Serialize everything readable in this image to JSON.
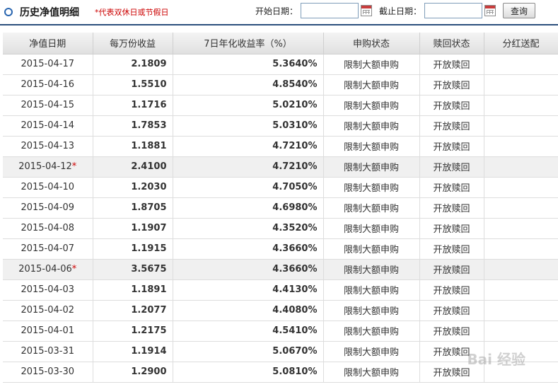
{
  "header": {
    "title": "历史净值明细",
    "note": "*代表双休日或节假日"
  },
  "filters": {
    "start_label": "开始日期：",
    "start_value": "",
    "end_label": "截止日期：",
    "end_value": "",
    "query_label": "查询"
  },
  "table": {
    "columns": [
      "净值日期",
      "每万份收益",
      "7日年化收益率（%）",
      "申购状态",
      "赎回状态",
      "分红送配"
    ],
    "rows": [
      {
        "date": "2015-04-17",
        "star": "",
        "income": "2.1809",
        "rate": "5.3640%",
        "buy": "限制大额申购",
        "redeem": "开放赎回",
        "dividend": ""
      },
      {
        "date": "2015-04-16",
        "star": "",
        "income": "1.5510",
        "rate": "4.8540%",
        "buy": "限制大额申购",
        "redeem": "开放赎回",
        "dividend": ""
      },
      {
        "date": "2015-04-15",
        "star": "",
        "income": "1.1716",
        "rate": "5.0210%",
        "buy": "限制大额申购",
        "redeem": "开放赎回",
        "dividend": ""
      },
      {
        "date": "2015-04-14",
        "star": "",
        "income": "1.7853",
        "rate": "5.0310%",
        "buy": "限制大额申购",
        "redeem": "开放赎回",
        "dividend": ""
      },
      {
        "date": "2015-04-13",
        "star": "",
        "income": "1.1881",
        "rate": "4.7210%",
        "buy": "限制大额申购",
        "redeem": "开放赎回",
        "dividend": ""
      },
      {
        "date": "2015-04-12",
        "star": "*",
        "income": "2.4100",
        "rate": "4.7210%",
        "buy": "限制大额申购",
        "redeem": "开放赎回",
        "dividend": ""
      },
      {
        "date": "2015-04-10",
        "star": "",
        "income": "1.2030",
        "rate": "4.7050%",
        "buy": "限制大额申购",
        "redeem": "开放赎回",
        "dividend": ""
      },
      {
        "date": "2015-04-09",
        "star": "",
        "income": "1.8705",
        "rate": "4.6980%",
        "buy": "限制大额申购",
        "redeem": "开放赎回",
        "dividend": ""
      },
      {
        "date": "2015-04-08",
        "star": "",
        "income": "1.1907",
        "rate": "4.3520%",
        "buy": "限制大额申购",
        "redeem": "开放赎回",
        "dividend": ""
      },
      {
        "date": "2015-04-07",
        "star": "",
        "income": "1.1915",
        "rate": "4.3660%",
        "buy": "限制大额申购",
        "redeem": "开放赎回",
        "dividend": ""
      },
      {
        "date": "2015-04-06",
        "star": "*",
        "income": "3.5675",
        "rate": "4.3660%",
        "buy": "限制大额申购",
        "redeem": "开放赎回",
        "dividend": ""
      },
      {
        "date": "2015-04-03",
        "star": "",
        "income": "1.1891",
        "rate": "4.4130%",
        "buy": "限制大额申购",
        "redeem": "开放赎回",
        "dividend": ""
      },
      {
        "date": "2015-04-02",
        "star": "",
        "income": "1.2077",
        "rate": "4.4080%",
        "buy": "限制大额申购",
        "redeem": "开放赎回",
        "dividend": ""
      },
      {
        "date": "2015-04-01",
        "star": "",
        "income": "1.2175",
        "rate": "4.5410%",
        "buy": "限制大额申购",
        "redeem": "开放赎回",
        "dividend": ""
      },
      {
        "date": "2015-03-31",
        "star": "",
        "income": "1.1914",
        "rate": "5.0670%",
        "buy": "限制大额申购",
        "redeem": "开放赎回",
        "dividend": ""
      },
      {
        "date": "2015-03-30",
        "star": "",
        "income": "1.2900",
        "rate": "5.0810%",
        "buy": "限制大额申购",
        "redeem": "开放赎回",
        "dividend": ""
      }
    ]
  },
  "colors": {
    "accent": "#2c4f7c",
    "note_red": "#cc0000",
    "holiday_row": "#f0f0f0"
  }
}
